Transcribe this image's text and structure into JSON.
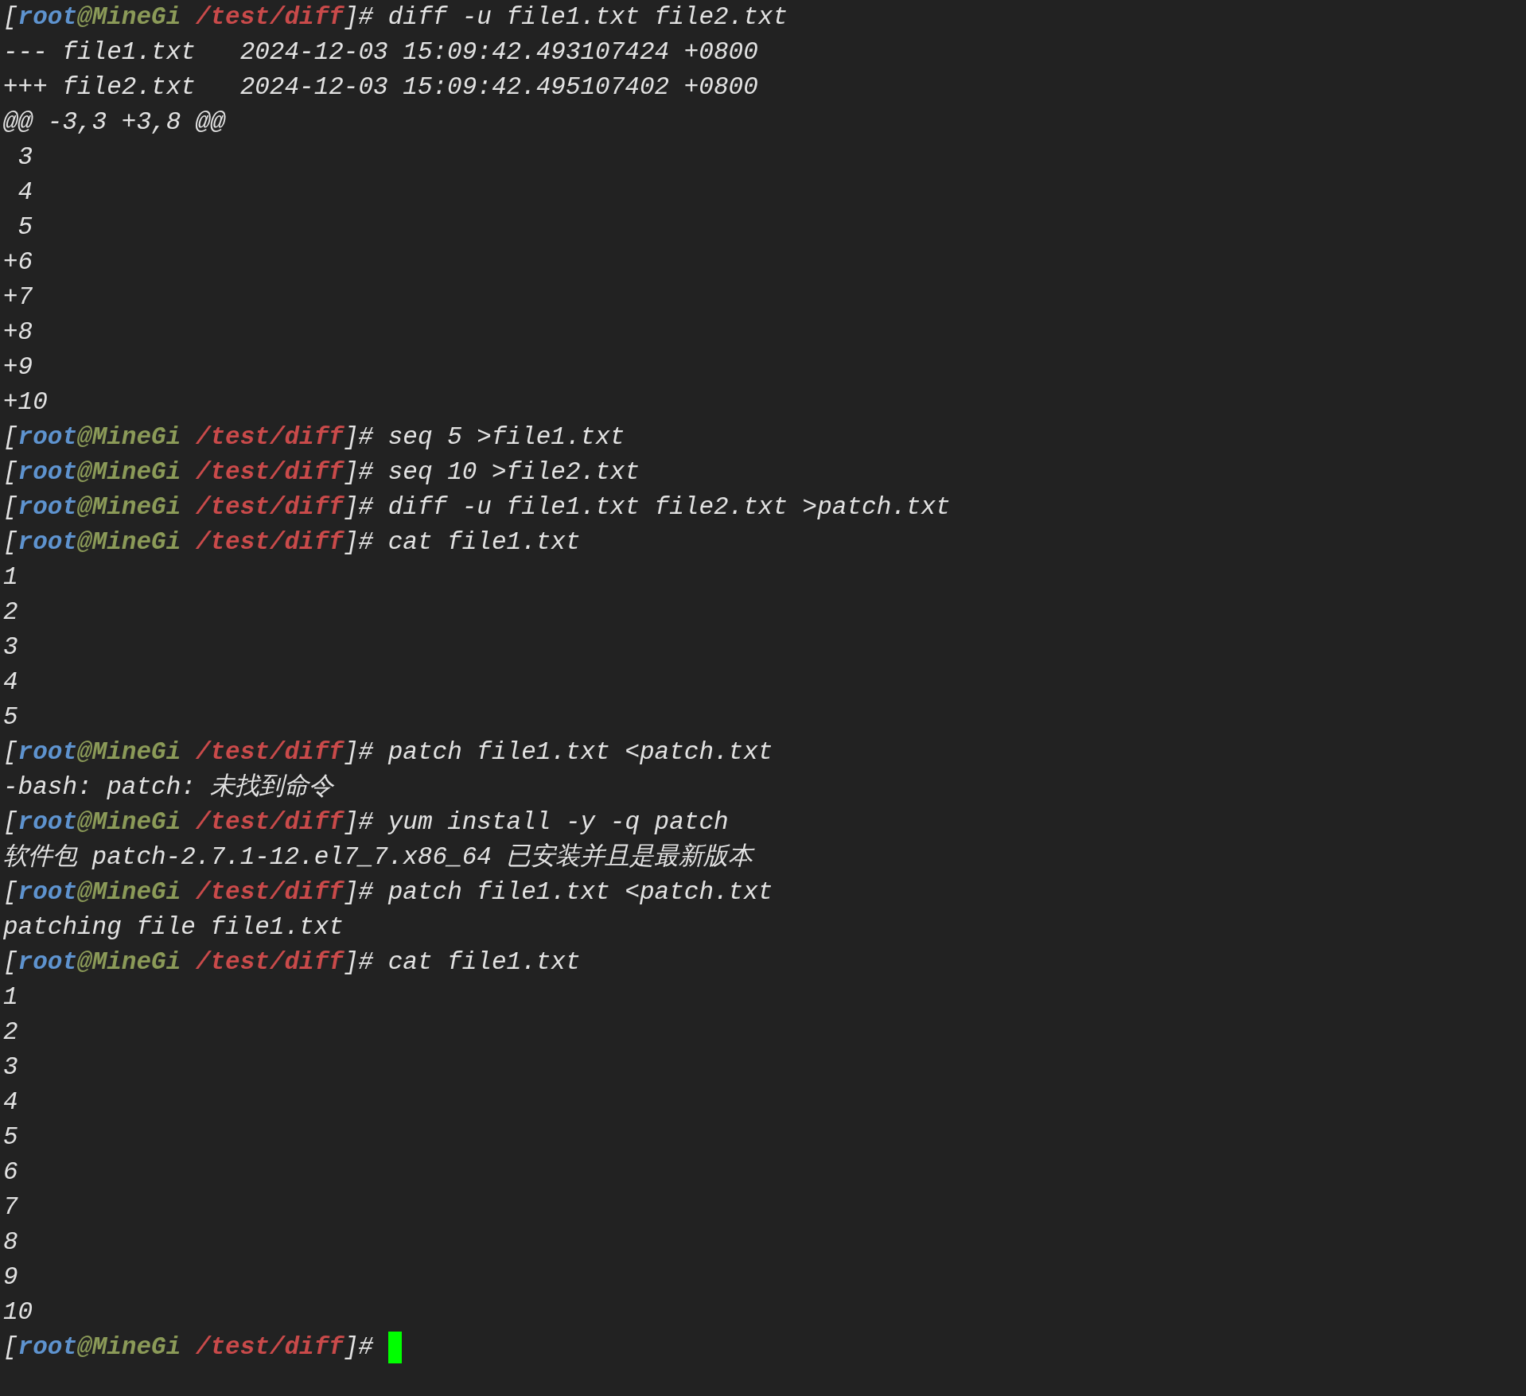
{
  "terminal": {
    "lines": [
      {
        "kind": "prompt",
        "lead": "[",
        "user": "root",
        "host": "@MineGi",
        "path": "/test/diff",
        "tail": "]#",
        "command": "diff -u file1.txt file2.txt"
      },
      {
        "kind": "output",
        "text": "--- file1.txt   2024-12-03 15:09:42.493107424 +0800"
      },
      {
        "kind": "output",
        "text": "+++ file2.txt   2024-12-03 15:09:42.495107402 +0800"
      },
      {
        "kind": "output",
        "text": "@@ -3,3 +3,8 @@"
      },
      {
        "kind": "output",
        "text": " 3"
      },
      {
        "kind": "output",
        "text": " 4"
      },
      {
        "kind": "output",
        "text": " 5"
      },
      {
        "kind": "output",
        "text": "+6"
      },
      {
        "kind": "output",
        "text": "+7"
      },
      {
        "kind": "output",
        "text": "+8"
      },
      {
        "kind": "output",
        "text": "+9"
      },
      {
        "kind": "output",
        "text": "+10"
      },
      {
        "kind": "prompt",
        "lead": "[",
        "user": "root",
        "host": "@MineGi",
        "path": "/test/diff",
        "tail": "]#",
        "command": "seq 5 >file1.txt"
      },
      {
        "kind": "prompt",
        "lead": "[",
        "user": "root",
        "host": "@MineGi",
        "path": "/test/diff",
        "tail": "]#",
        "command": "seq 10 >file2.txt"
      },
      {
        "kind": "prompt",
        "lead": "[",
        "user": "root",
        "host": "@MineGi",
        "path": "/test/diff",
        "tail": "]#",
        "command": "diff -u file1.txt file2.txt >patch.txt"
      },
      {
        "kind": "prompt",
        "lead": "[",
        "user": "root",
        "host": "@MineGi",
        "path": "/test/diff",
        "tail": "]#",
        "command": "cat file1.txt"
      },
      {
        "kind": "output",
        "text": "1"
      },
      {
        "kind": "output",
        "text": "2"
      },
      {
        "kind": "output",
        "text": "3"
      },
      {
        "kind": "output",
        "text": "4"
      },
      {
        "kind": "output",
        "text": "5"
      },
      {
        "kind": "prompt",
        "lead": "[",
        "user": "root",
        "host": "@MineGi",
        "path": "/test/diff",
        "tail": "]#",
        "command": "patch file1.txt <patch.txt"
      },
      {
        "kind": "output",
        "text": "-bash: patch: 未找到命令"
      },
      {
        "kind": "prompt",
        "lead": "[",
        "user": "root",
        "host": "@MineGi",
        "path": "/test/diff",
        "tail": "]#",
        "command": "yum install -y -q patch"
      },
      {
        "kind": "output",
        "text": "软件包 patch-2.7.1-12.el7_7.x86_64 已安装并且是最新版本"
      },
      {
        "kind": "prompt",
        "lead": "[",
        "user": "root",
        "host": "@MineGi",
        "path": "/test/diff",
        "tail": "]#",
        "command": "patch file1.txt <patch.txt"
      },
      {
        "kind": "output",
        "text": "patching file file1.txt"
      },
      {
        "kind": "prompt",
        "lead": "[",
        "user": "root",
        "host": "@MineGi",
        "path": "/test/diff",
        "tail": "]#",
        "command": "cat file1.txt"
      },
      {
        "kind": "output",
        "text": "1"
      },
      {
        "kind": "output",
        "text": "2"
      },
      {
        "kind": "output",
        "text": "3"
      },
      {
        "kind": "output",
        "text": "4"
      },
      {
        "kind": "output",
        "text": "5"
      },
      {
        "kind": "output",
        "text": "6"
      },
      {
        "kind": "output",
        "text": "7"
      },
      {
        "kind": "output",
        "text": "8"
      },
      {
        "kind": "output",
        "text": "9"
      },
      {
        "kind": "output",
        "text": "10"
      },
      {
        "kind": "prompt",
        "lead": "[",
        "user": "root",
        "host": "@MineGi",
        "path": "/test/diff",
        "tail": "]#",
        "cursor": true
      }
    ]
  }
}
